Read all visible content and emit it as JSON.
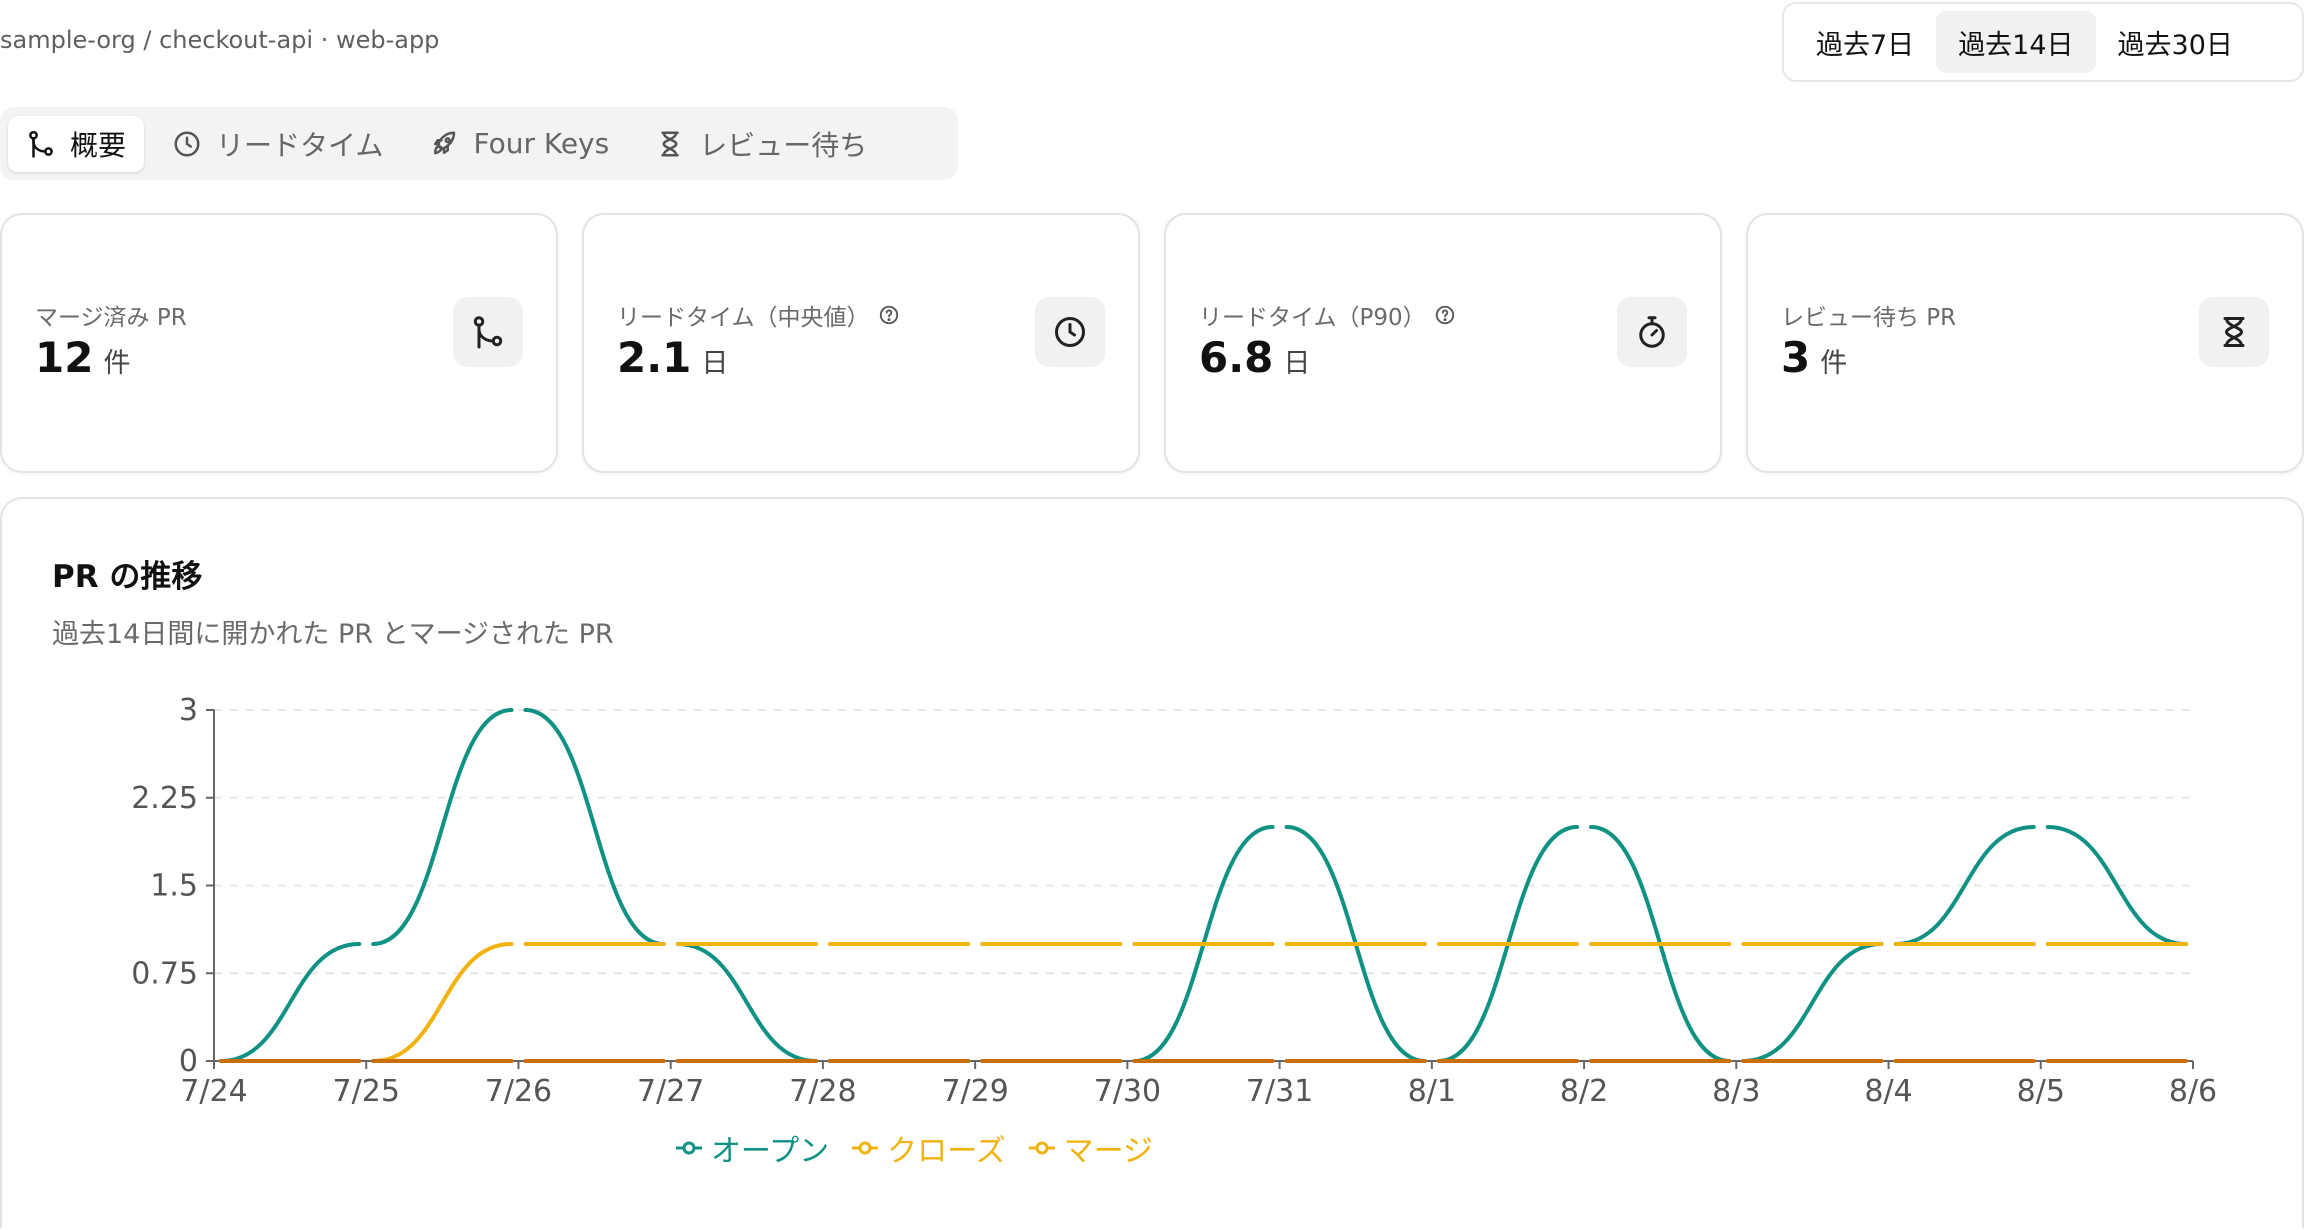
{
  "header": {
    "breadcrumb": "sample-org / checkout-api · web-app",
    "ranges": [
      "過去7日",
      "過去14日",
      "過去30日"
    ],
    "active_range": "過去14日"
  },
  "tabs": [
    {
      "label": "概要",
      "icon": "git-merge-icon",
      "active": true
    },
    {
      "label": "リードタイム",
      "icon": "clock-icon",
      "active": false
    },
    {
      "label": "Four Keys",
      "icon": "rocket-icon",
      "active": false
    },
    {
      "label": "レビュー待ち",
      "icon": "hourglass-icon",
      "active": false
    }
  ],
  "cards": [
    {
      "label": "マージ済み PR",
      "value": "12",
      "unit": "件",
      "icon": "git-merge-icon",
      "help": false
    },
    {
      "label": "リードタイム（中央値）",
      "value": "2.1",
      "unit": "日",
      "icon": "clock-icon",
      "help": true
    },
    {
      "label": "リードタイム（P90）",
      "value": "6.8",
      "unit": "日",
      "icon": "stopwatch-icon",
      "help": true
    },
    {
      "label": "レビュー待ち PR",
      "value": "3",
      "unit": "件",
      "icon": "hourglass-icon",
      "help": false
    }
  ],
  "chart": {
    "title": "PR の推移",
    "subtitle": "過去14日間に開かれた PR とマージされた PR"
  },
  "chart_data": {
    "type": "line",
    "x": [
      "7/24",
      "7/25",
      "7/26",
      "7/27",
      "7/28",
      "7/29",
      "7/30",
      "7/31",
      "8/1",
      "8/2",
      "8/3",
      "8/4",
      "8/5",
      "8/6"
    ],
    "yticks": [
      "0",
      "0.75",
      "1.5",
      "2.25",
      "3"
    ],
    "ylim": [
      0,
      3
    ],
    "grid": true,
    "legend": "bottom",
    "series": [
      {
        "name": "オープン",
        "color": "#0f9184",
        "values": [
          0,
          1,
          3,
          1,
          0,
          0,
          0,
          2,
          0,
          2,
          0,
          1,
          2,
          1
        ]
      },
      {
        "name": "クローズ",
        "color": "#f2b20c",
        "values": [
          0,
          0,
          1,
          1,
          1,
          1,
          1,
          1,
          1,
          1,
          1,
          1,
          1,
          1
        ]
      },
      {
        "name": "マージ",
        "color": "#f2b20c",
        "values": [
          0,
          0,
          0,
          0,
          0,
          0,
          0,
          0,
          0,
          0,
          0,
          0,
          0,
          0
        ]
      }
    ]
  }
}
